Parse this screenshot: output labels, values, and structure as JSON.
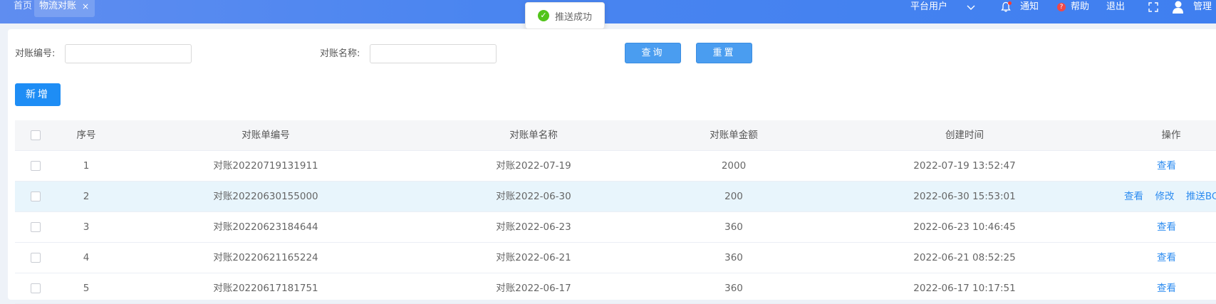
{
  "topbar": {
    "home": "首页",
    "tab": "物流对账",
    "tab_close": "×",
    "user": "平台用户",
    "notify": "通知",
    "help": "帮助",
    "logout": "退出",
    "admin": "管理"
  },
  "toast": {
    "text": "推送成功"
  },
  "search": {
    "code_label": "对账编号:",
    "name_label": "对账名称:",
    "code_value": "",
    "name_value": "",
    "query_label": "查询",
    "reset_label": "重置"
  },
  "add_label": "新增",
  "table": {
    "headers": [
      "序号",
      "对账单编号",
      "对账单名称",
      "对账单金额",
      "创建时间",
      "操作"
    ],
    "rows": [
      {
        "idx": "1",
        "code": "对账20220719131911",
        "name": "对账2022-07-19",
        "amount": "2000",
        "time": "2022-07-19 13:52:47",
        "ops": [
          "查看"
        ]
      },
      {
        "idx": "2",
        "code": "对账20220630155000",
        "name": "对账2022-06-30",
        "amount": "200",
        "time": "2022-06-30 15:53:01",
        "ops": [
          "查看",
          "修改",
          "推送BCP"
        ]
      },
      {
        "idx": "3",
        "code": "对账20220623184644",
        "name": "对账2022-06-23",
        "amount": "360",
        "time": "2022-06-23 10:46:45",
        "ops": [
          "查看"
        ]
      },
      {
        "idx": "4",
        "code": "对账20220621165224",
        "name": "对账2022-06-21",
        "amount": "360",
        "time": "2022-06-21 08:52:25",
        "ops": [
          "查看"
        ]
      },
      {
        "idx": "5",
        "code": "对账20220617181751",
        "name": "对账2022-06-17",
        "amount": "360",
        "time": "2022-06-17 10:17:51",
        "ops": [
          "查看"
        ]
      }
    ]
  },
  "colors": {
    "primary": "#1e8df5",
    "link": "#2d8cf0",
    "success": "#52c41a",
    "highlight_row": "#e8f5fc"
  }
}
